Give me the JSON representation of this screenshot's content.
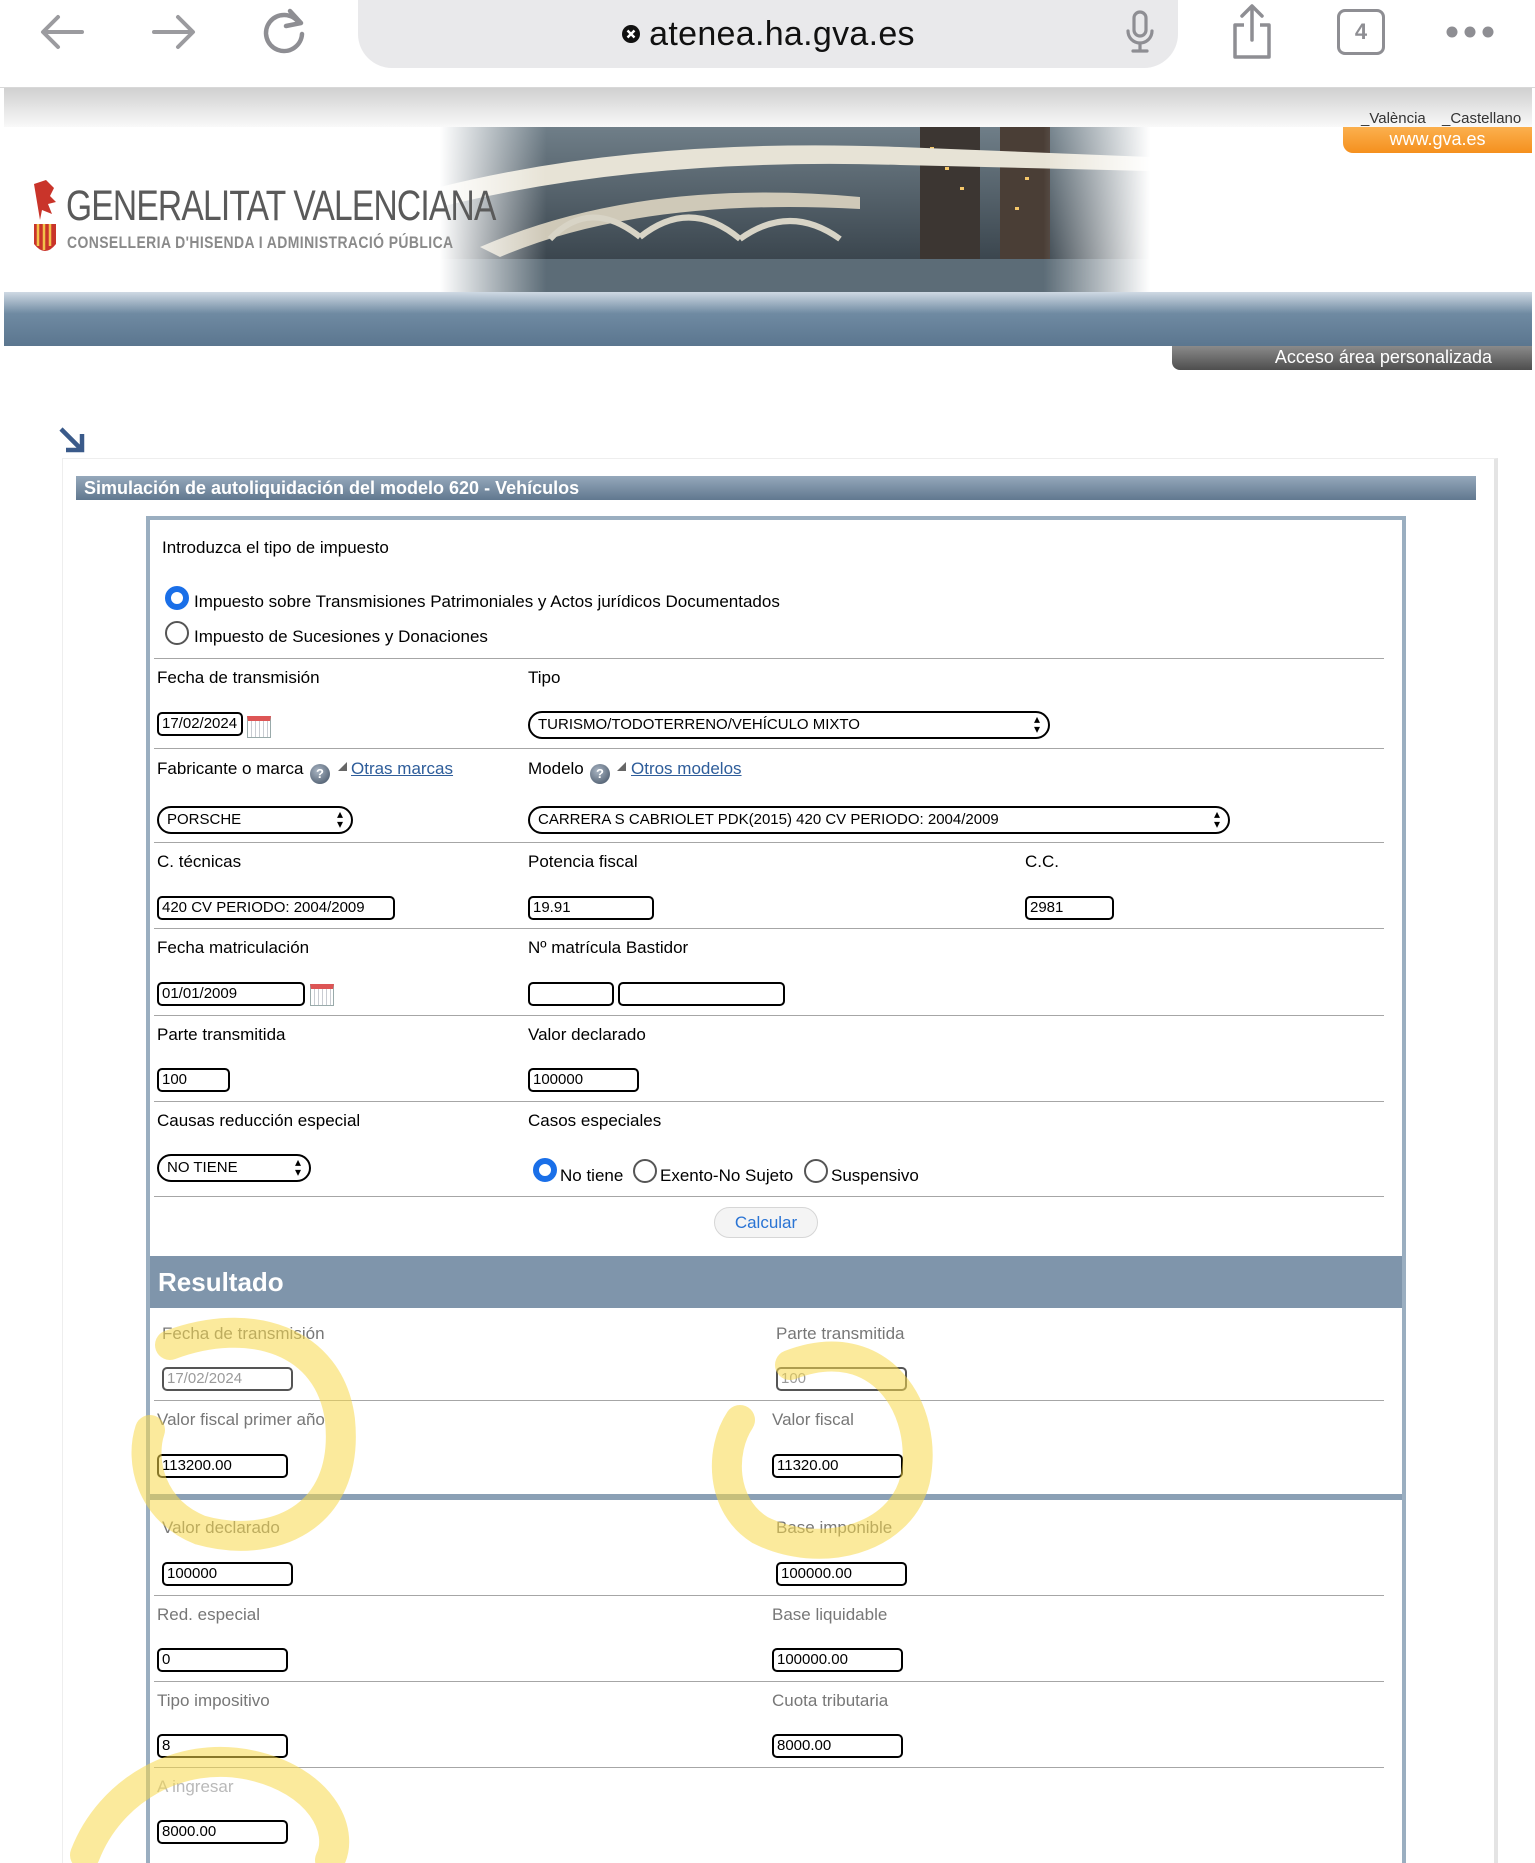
{
  "browser": {
    "url": "atenea.ha.gva.es",
    "tab_count": "4",
    "icons": [
      "back-arrow-icon",
      "forward-arrow-icon",
      "reload-icon",
      "stop-icon",
      "microphone-icon",
      "share-icon",
      "more-icon"
    ]
  },
  "header": {
    "lang_valencia": "_València",
    "lang_castellano": "_Castellano",
    "gva_link": "www.gva.es",
    "logo_title": "GENERALITAT VALENCIANA",
    "logo_subtitle": "CONSELLERIA D'HISENDA I ADMINISTRACIÓ PÚBLICA",
    "acceso": "Acceso área personalizada"
  },
  "form": {
    "title": "Simulación de autoliquidación del modelo 620 - Vehículos",
    "intro": "Introduzca el tipo de impuesto",
    "impuesto_options": [
      {
        "label": "Impuesto sobre Transmisiones Patrimoniales y Actos jurídicos Documentados",
        "selected": true
      },
      {
        "label": "Impuesto de Sucesiones y Donaciones",
        "selected": false
      }
    ],
    "fecha_transmision_label": "Fecha de transmisión",
    "fecha_transmision_value": "17/02/2024",
    "tipo_label": "Tipo",
    "tipo_value": "TURISMO/TODOTERRENO/VEHÍCULO MIXTO",
    "fabricante_label": "Fabricante o marca",
    "otras_marcas": "Otras marcas",
    "fabricante_value": "PORSCHE",
    "modelo_label": "Modelo",
    "otros_modelos": "Otros modelos",
    "modelo_value": "CARRERA S CABRIOLET PDK(2015) 420 CV PERIODO: 2004/2009",
    "ctecnicas_label": "C. técnicas",
    "ctecnicas_value": "420 CV PERIODO: 2004/2009",
    "potencia_label": "Potencia fiscal",
    "potencia_value": "19.91",
    "cc_label": "C.C.",
    "cc_value": "2981",
    "fecha_matric_label": "Fecha matriculación",
    "fecha_matric_value": "01/01/2009",
    "matricula_label": "Nº matrícula Bastidor",
    "matricula_value": "",
    "bastidor_value": "",
    "parte_label": "Parte transmitida",
    "parte_value": "100",
    "valor_decl_label": "Valor declarado",
    "valor_decl_value": "100000",
    "causas_label": "Causas reducción especial",
    "causas_value": "NO TIENE",
    "casos_label": "Casos especiales",
    "casos_options": [
      {
        "label": "No tiene",
        "selected": true
      },
      {
        "label": "Exento-No Sujeto",
        "selected": false
      },
      {
        "label": "Suspensivo",
        "selected": false
      }
    ],
    "calcular": "Calcular"
  },
  "resultado": {
    "title": "Resultado",
    "fecha_transmision_label": "Fecha de transmisión",
    "fecha_transmision_value": "17/02/2024",
    "parte_label": "Parte transmitida",
    "parte_value": "100",
    "valor_fiscal_primer_label": "Valor fiscal primer año",
    "valor_fiscal_primer_value": "113200.00",
    "valor_fiscal_label": "Valor fiscal",
    "valor_fiscal_value": "11320.00",
    "valor_decl_label": "Valor declarado",
    "valor_decl_value": "100000",
    "base_imponible_label": "Base imponible",
    "base_imponible_value": "100000.00",
    "red_especial_label": "Red. especial",
    "red_especial_value": "0",
    "base_liquidable_label": "Base liquidable",
    "base_liquidable_value": "100000.00",
    "tipo_imp_label": "Tipo impositivo",
    "tipo_imp_value": "8",
    "cuota_label": "Cuota tributaria",
    "cuota_value": "8000.00",
    "a_ingresar_label": "A ingresar",
    "a_ingresar_value": "8000.00"
  },
  "colors": {
    "highlight": "#f7d84a",
    "accent_blue": "#1a6fe8",
    "bar_blue": "#7f95ab",
    "orange": "#f5901e"
  }
}
